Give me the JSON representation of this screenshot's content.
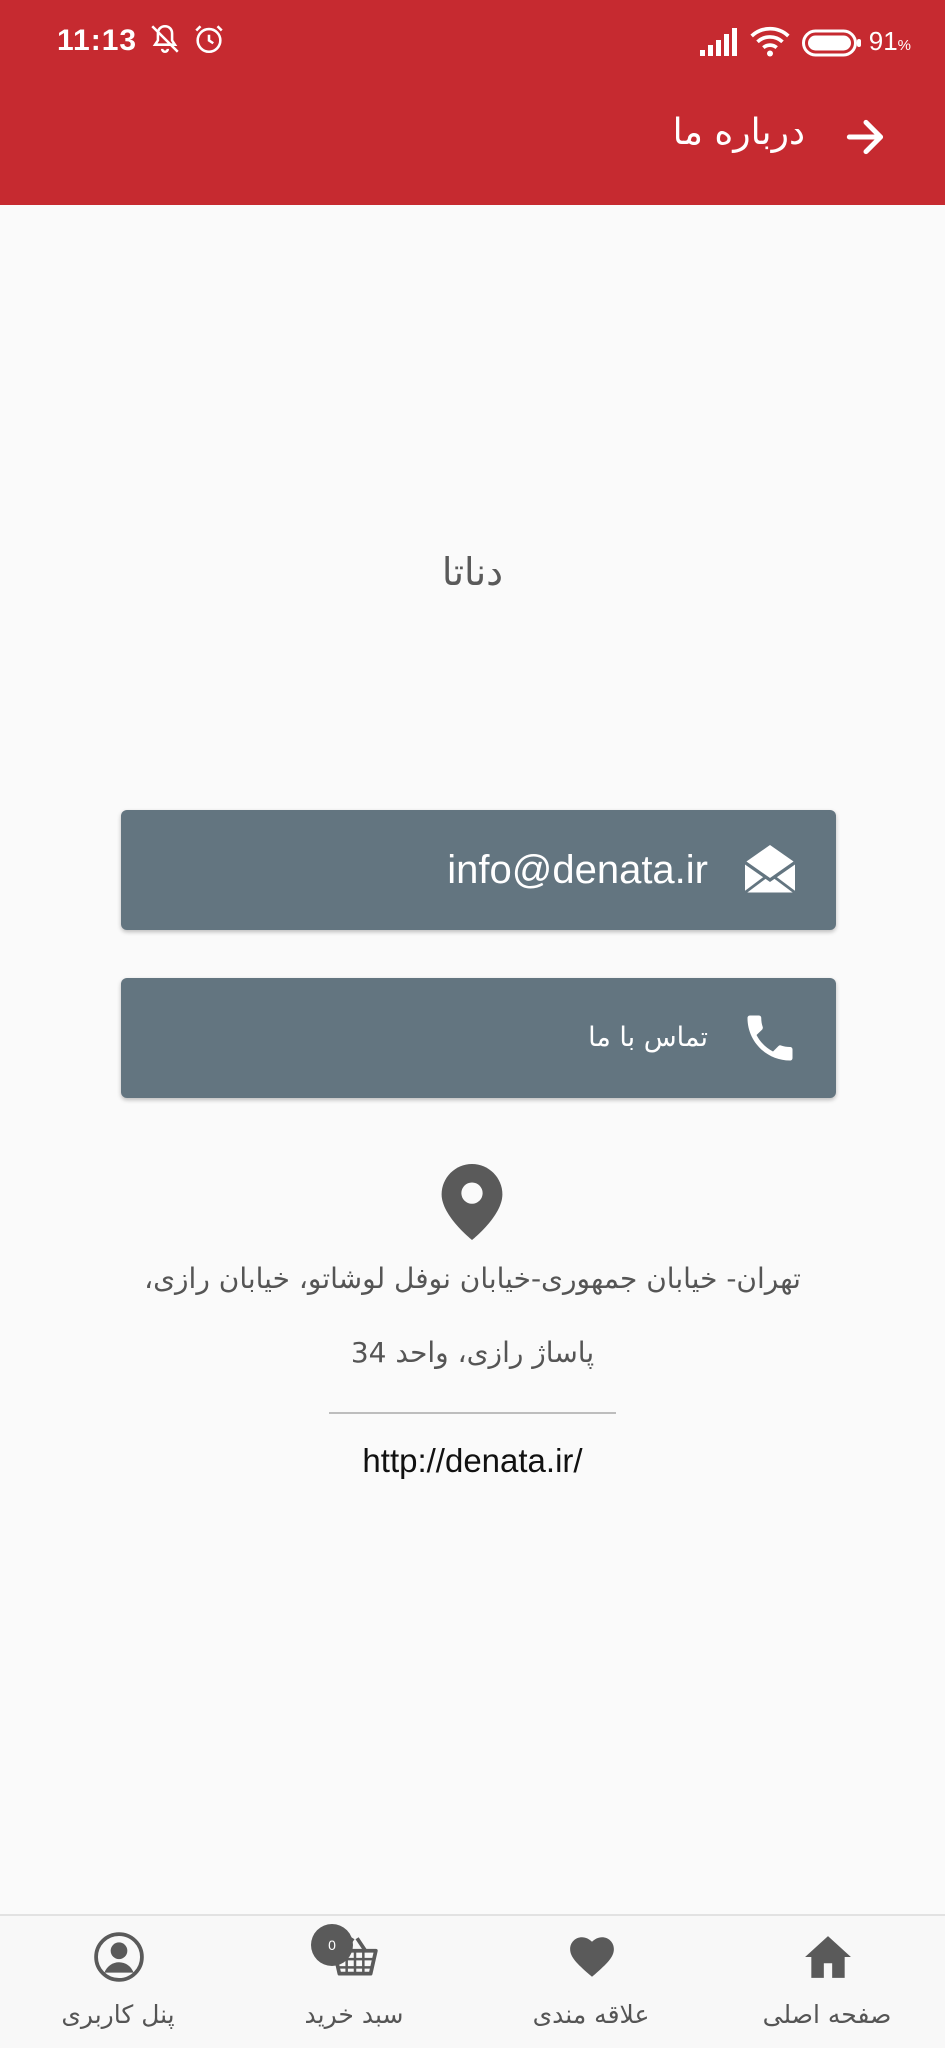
{
  "status_bar": {
    "time": "11:13",
    "battery_percent": "91",
    "battery_unit": "%"
  },
  "app_bar": {
    "title": "درباره ما"
  },
  "brand_name": "دناتا",
  "contact": {
    "email": "info@denata.ir",
    "call_label": "تماس با ما"
  },
  "address": {
    "line1": "تهران- خیابان جمهوری-خیابان نوفل لوشاتو، خیابان رازی،",
    "line2": "پاساژ رازی، واحد 34"
  },
  "website": "http://denata.ir/",
  "bottom_nav": {
    "home": "صفحه اصلی",
    "favorites": "علاقه مندی",
    "cart": "سبد خرید",
    "cart_count": "0",
    "user_panel": "پنل کاربری"
  },
  "colors": {
    "app_bar": "#c62a30",
    "button": "#637580",
    "background": "#fafafa",
    "icon_gray": "#5a5a5a"
  },
  "icons": [
    "muted-bell-icon",
    "alarm-icon",
    "signal-icon",
    "wifi-icon",
    "battery-icon",
    "back-arrow-icon",
    "envelope-icon",
    "phone-icon",
    "location-pin-icon",
    "home-icon",
    "heart-icon",
    "cart-icon",
    "user-icon"
  ]
}
